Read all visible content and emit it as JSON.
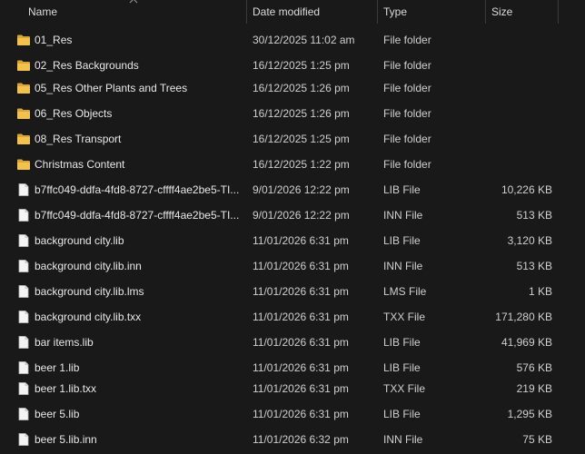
{
  "columns": {
    "name": "Name",
    "date": "Date modified",
    "type": "Type",
    "size": "Size"
  },
  "files": [
    {
      "name": "01_Res",
      "date": "30/12/2025 11:02 am",
      "type": "File folder",
      "size": "",
      "icon": "folder-icon"
    },
    {
      "name": "02_Res  Backgrounds",
      "date": "16/12/2025 1:25 pm",
      "type": "File folder",
      "size": "",
      "icon": "folder-icon"
    },
    {
      "name": "05_Res Other Plants and Trees",
      "date": "16/12/2025 1:26 pm",
      "type": "File folder",
      "size": "",
      "icon": "folder-icon"
    },
    {
      "name": "06_Res Objects",
      "date": "16/12/2025 1:26 pm",
      "type": "File folder",
      "size": "",
      "icon": "folder-icon"
    },
    {
      "name": "08_Res Transport",
      "date": "16/12/2025 1:25 pm",
      "type": "File folder",
      "size": "",
      "icon": "folder-icon"
    },
    {
      "name": "Christmas Content",
      "date": "16/12/2025 1:22 pm",
      "type": "File folder",
      "size": "",
      "icon": "folder-icon"
    },
    {
      "name": "b7ffc049-ddfa-4fd8-8727-cffff4ae2be5-TI...",
      "date": "9/01/2026 12:22 pm",
      "type": "LIB File",
      "size": "10,226 KB",
      "icon": "file-icon"
    },
    {
      "name": "b7ffc049-ddfa-4fd8-8727-cffff4ae2be5-TI...",
      "date": "9/01/2026 12:22 pm",
      "type": "INN File",
      "size": "513 KB",
      "icon": "file-icon"
    },
    {
      "name": "background city.lib",
      "date": "11/01/2026 6:31 pm",
      "type": "LIB File",
      "size": "3,120 KB",
      "icon": "file-icon"
    },
    {
      "name": "background city.lib.inn",
      "date": "11/01/2026 6:31 pm",
      "type": "INN File",
      "size": "513 KB",
      "icon": "file-icon"
    },
    {
      "name": "background city.lib.lms",
      "date": "11/01/2026 6:31 pm",
      "type": "LMS File",
      "size": "1 KB",
      "icon": "file-icon"
    },
    {
      "name": "background city.lib.txx",
      "date": "11/01/2026 6:31 pm",
      "type": "TXX File",
      "size": "171,280 KB",
      "icon": "file-icon"
    },
    {
      "name": "bar items.lib",
      "date": "11/01/2026 6:31 pm",
      "type": "LIB File",
      "size": "41,969 KB",
      "icon": "file-icon"
    },
    {
      "name": "beer 1.lib",
      "date": "11/01/2026 6:31 pm",
      "type": "LIB File",
      "size": "576 KB",
      "icon": "file-icon"
    },
    {
      "name": "beer 1.lib.txx",
      "date": "11/01/2026 6:31 pm",
      "type": "TXX File",
      "size": "219 KB",
      "icon": "file-icon"
    },
    {
      "name": "beer 5.lib",
      "date": "11/01/2026 6:31 pm",
      "type": "LIB File",
      "size": "1,295 KB",
      "icon": "file-icon"
    },
    {
      "name": "beer 5.lib.inn",
      "date": "11/01/2026 6:32 pm",
      "type": "INN File",
      "size": "75 KB",
      "icon": "file-icon"
    }
  ],
  "colors": {
    "background": "#191919",
    "folder": "#f2c14e",
    "text": "#e6e6e6"
  }
}
